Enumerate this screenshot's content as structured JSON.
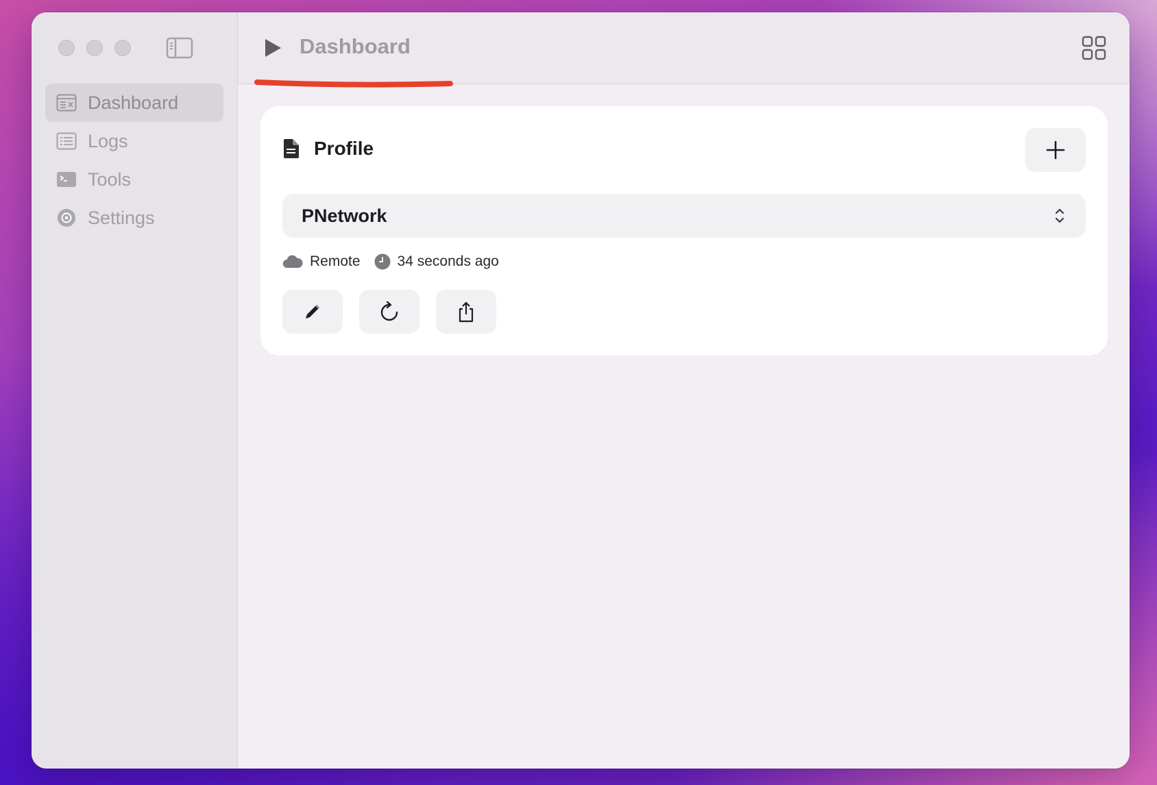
{
  "window": {
    "traffic_lights": [
      "close",
      "minimize",
      "zoom"
    ],
    "sidebar_toggle_icon": "sidebar-left-icon"
  },
  "sidebar": {
    "items": [
      {
        "label": "Dashboard",
        "icon": "dashboard-icon",
        "active": true
      },
      {
        "label": "Logs",
        "icon": "list-icon",
        "active": false
      },
      {
        "label": "Tools",
        "icon": "terminal-icon",
        "active": false
      },
      {
        "label": "Settings",
        "icon": "gear-icon",
        "active": false
      }
    ]
  },
  "header": {
    "title": "Dashboard",
    "left_icon": "play-icon",
    "right_icon": "grid-icon",
    "annotation_color": "#e8402a"
  },
  "profile": {
    "title": "Profile",
    "title_icon": "document-icon",
    "add_icon": "plus-icon",
    "selected": "PNetwork",
    "source": "Remote",
    "source_icon": "cloud-icon",
    "updated": "34 seconds ago",
    "updated_icon": "clock-icon",
    "actions": [
      {
        "icon": "pencil-icon"
      },
      {
        "icon": "refresh-icon"
      },
      {
        "icon": "share-icon"
      }
    ]
  }
}
